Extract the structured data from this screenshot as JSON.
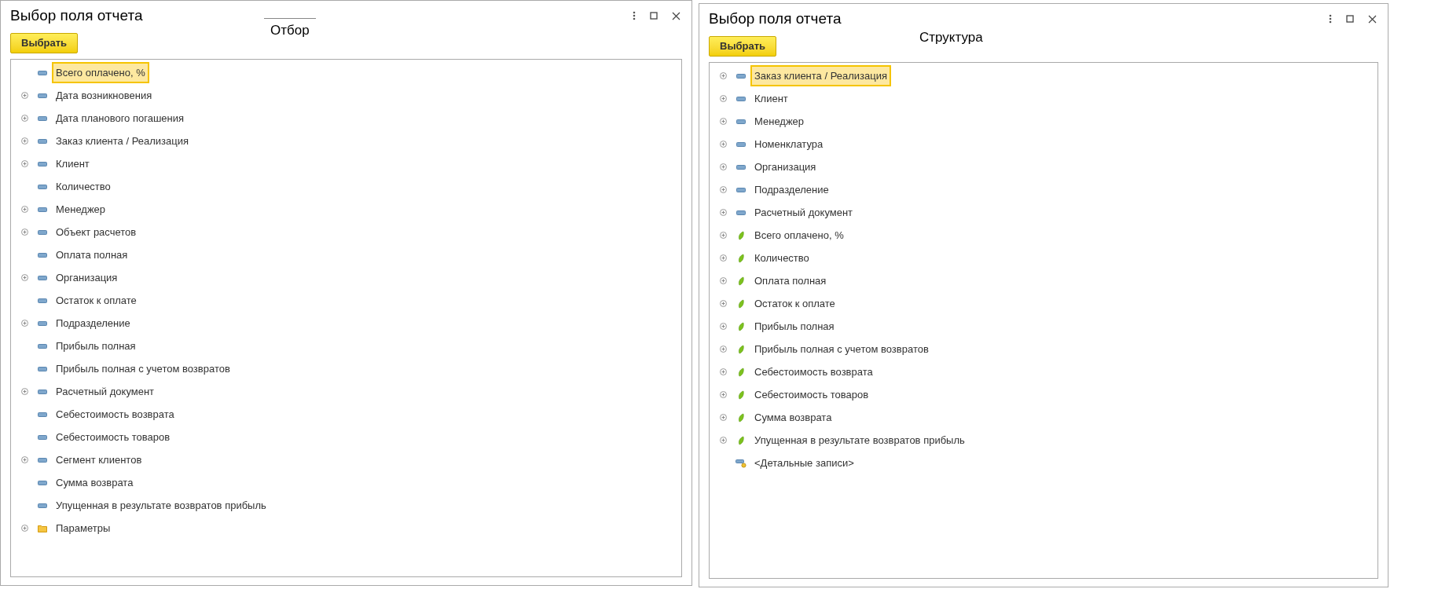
{
  "windows": [
    {
      "title": "Выбор поля отчета",
      "caption": "Отбор",
      "button": "Выбрать",
      "items": [
        {
          "label": "Всего оплачено, %",
          "kind": "field",
          "expandable": false,
          "selected": true
        },
        {
          "label": "Дата возникновения",
          "kind": "field",
          "expandable": true,
          "selected": false
        },
        {
          "label": "Дата планового погашения",
          "kind": "field",
          "expandable": true,
          "selected": false
        },
        {
          "label": "Заказ клиента / Реализация",
          "kind": "field",
          "expandable": true,
          "selected": false
        },
        {
          "label": "Клиент",
          "kind": "field",
          "expandable": true,
          "selected": false
        },
        {
          "label": "Количество",
          "kind": "field",
          "expandable": false,
          "selected": false
        },
        {
          "label": "Менеджер",
          "kind": "field",
          "expandable": true,
          "selected": false
        },
        {
          "label": "Объект расчетов",
          "kind": "field",
          "expandable": true,
          "selected": false
        },
        {
          "label": "Оплата полная",
          "kind": "field",
          "expandable": false,
          "selected": false
        },
        {
          "label": "Организация",
          "kind": "field",
          "expandable": true,
          "selected": false
        },
        {
          "label": "Остаток к оплате",
          "kind": "field",
          "expandable": false,
          "selected": false
        },
        {
          "label": "Подразделение",
          "kind": "field",
          "expandable": true,
          "selected": false
        },
        {
          "label": "Прибыль полная",
          "kind": "field",
          "expandable": false,
          "selected": false
        },
        {
          "label": "Прибыль полная с учетом возвратов",
          "kind": "field",
          "expandable": false,
          "selected": false
        },
        {
          "label": "Расчетный документ",
          "kind": "field",
          "expandable": true,
          "selected": false
        },
        {
          "label": "Себестоимость возврата",
          "kind": "field",
          "expandable": false,
          "selected": false
        },
        {
          "label": "Себестоимость товаров",
          "kind": "field",
          "expandable": false,
          "selected": false
        },
        {
          "label": "Сегмент клиентов",
          "kind": "field",
          "expandable": true,
          "selected": false
        },
        {
          "label": "Сумма возврата",
          "kind": "field",
          "expandable": false,
          "selected": false
        },
        {
          "label": "Упущенная в результате возвратов прибыль",
          "kind": "field",
          "expandable": false,
          "selected": false
        },
        {
          "label": "Параметры",
          "kind": "folder",
          "expandable": true,
          "selected": false
        }
      ]
    },
    {
      "title": "Выбор поля отчета",
      "caption": "Структура",
      "button": "Выбрать",
      "items": [
        {
          "label": "Заказ клиента / Реализация",
          "kind": "field",
          "expandable": true,
          "selected": true
        },
        {
          "label": "Клиент",
          "kind": "field",
          "expandable": true,
          "selected": false
        },
        {
          "label": "Менеджер",
          "kind": "field",
          "expandable": true,
          "selected": false
        },
        {
          "label": "Номенклатура",
          "kind": "field",
          "expandable": true,
          "selected": false
        },
        {
          "label": "Организация",
          "kind": "field",
          "expandable": true,
          "selected": false
        },
        {
          "label": "Подразделение",
          "kind": "field",
          "expandable": true,
          "selected": false
        },
        {
          "label": "Расчетный документ",
          "kind": "field",
          "expandable": true,
          "selected": false
        },
        {
          "label": "Всего оплачено, %",
          "kind": "resource",
          "expandable": true,
          "selected": false
        },
        {
          "label": "Количество",
          "kind": "resource",
          "expandable": true,
          "selected": false
        },
        {
          "label": "Оплата полная",
          "kind": "resource",
          "expandable": true,
          "selected": false
        },
        {
          "label": "Остаток к оплате",
          "kind": "resource",
          "expandable": true,
          "selected": false
        },
        {
          "label": "Прибыль полная",
          "kind": "resource",
          "expandable": true,
          "selected": false
        },
        {
          "label": "Прибыль полная с учетом возвратов",
          "kind": "resource",
          "expandable": true,
          "selected": false
        },
        {
          "label": "Себестоимость возврата",
          "kind": "resource",
          "expandable": true,
          "selected": false
        },
        {
          "label": "Себестоимость товаров",
          "kind": "resource",
          "expandable": true,
          "selected": false
        },
        {
          "label": "Сумма возврата",
          "kind": "resource",
          "expandable": true,
          "selected": false
        },
        {
          "label": "Упущенная в результате возвратов прибыль",
          "kind": "resource",
          "expandable": true,
          "selected": false
        },
        {
          "label": "<Детальные записи>",
          "kind": "detail",
          "expandable": false,
          "selected": false
        }
      ]
    }
  ]
}
